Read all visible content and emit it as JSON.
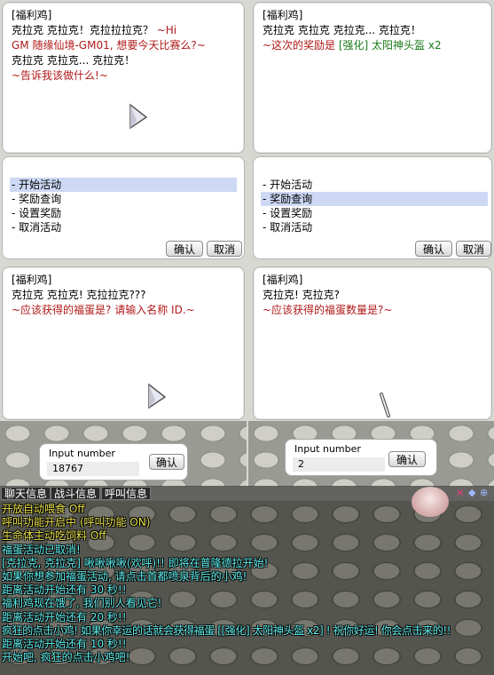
{
  "panels": {
    "top_left": {
      "npc": "[福利鸡]",
      "lines": [
        {
          "text": "克拉克 克拉克！克拉拉拉克？ ~Hi",
          "color": "black_red"
        },
        {
          "text": "GM 随缘仙境-GM01, 想要今天比赛么?~",
          "color": "red"
        },
        {
          "text": "克拉克 克拉克... 克拉克！",
          "color": "black"
        },
        {
          "text": "~告诉我该做什么!~",
          "color": "red"
        }
      ]
    },
    "top_right": {
      "npc": "[福利鸡]",
      "line1": "克拉克 克拉克 克拉克... 克拉克！",
      "line2_red": "~这次的奖励是 ",
      "line2_green": "[强化] 太阳神头盔 x2"
    },
    "menu_left": {
      "items": [
        "- 开始活动",
        "- 奖励查询",
        "- 设置奖励",
        "- 取消活动"
      ],
      "selected": 0,
      "ok": "确认",
      "cancel": "取消"
    },
    "menu_right": {
      "items": [
        "- 开始活动",
        "- 奖励查询",
        "- 设置奖励",
        "- 取消活动"
      ],
      "selected": 1,
      "ok": "确认",
      "cancel": "取消"
    },
    "bottom_left": {
      "npc": "[福利鸡]",
      "line1": "克拉克 克拉克! 克拉拉克???",
      "line2": "~应该获得的福蛋是? 请输入名称 ID.~"
    },
    "bottom_right": {
      "npc": "[福利鸡]",
      "line1": "克拉克! 克拉克?",
      "line2": "~应该获得的福蛋数量是?~"
    },
    "input_left": {
      "label": "Input number",
      "value": "18767",
      "ok": "确认"
    },
    "input_right": {
      "label": "Input number",
      "value": "2",
      "ok": "确认"
    }
  },
  "chat": {
    "tabs": [
      "聊天信息",
      "战斗信息",
      "呼叫信息"
    ],
    "lines": [
      {
        "text": "开放自动喂食 Off",
        "color": "y"
      },
      {
        "text": "呼叫功能开启中 (呼叫功能 ON)",
        "color": "y"
      },
      {
        "text": "生命体主动吃饲料 Off",
        "color": "y"
      },
      {
        "text": "福蛋活动已取消!",
        "color": "c"
      },
      {
        "text": "[克拉克, 克拉克] 啾啾啾啾(欢呼)!! 即将在普隆德拉开始!",
        "color": "c"
      },
      {
        "text": "如果你想参加福蛋活动, 请点击首都喷泉背后的小鸡!",
        "color": "c"
      },
      {
        "text": "距离活动开始还有 30 秒!!",
        "color": "c"
      },
      {
        "text": "福利鸡现在饿了, 我们别人看见它!",
        "color": "c"
      },
      {
        "text": "距离活动开始还有 20 秒!!",
        "color": "c"
      },
      {
        "text": "疯狂的点击小鸡! 如果你幸运的话就会获得福蛋 [[强化] 太阳神头盔 x2] ! 祝你好运! 你会点击来的!!",
        "color": "c"
      },
      {
        "text": "距离活动开始还有 10 秒!!",
        "color": "c"
      },
      {
        "text": "开始吧, 疯狂的点击小鸡吧!",
        "color": "c"
      }
    ]
  }
}
